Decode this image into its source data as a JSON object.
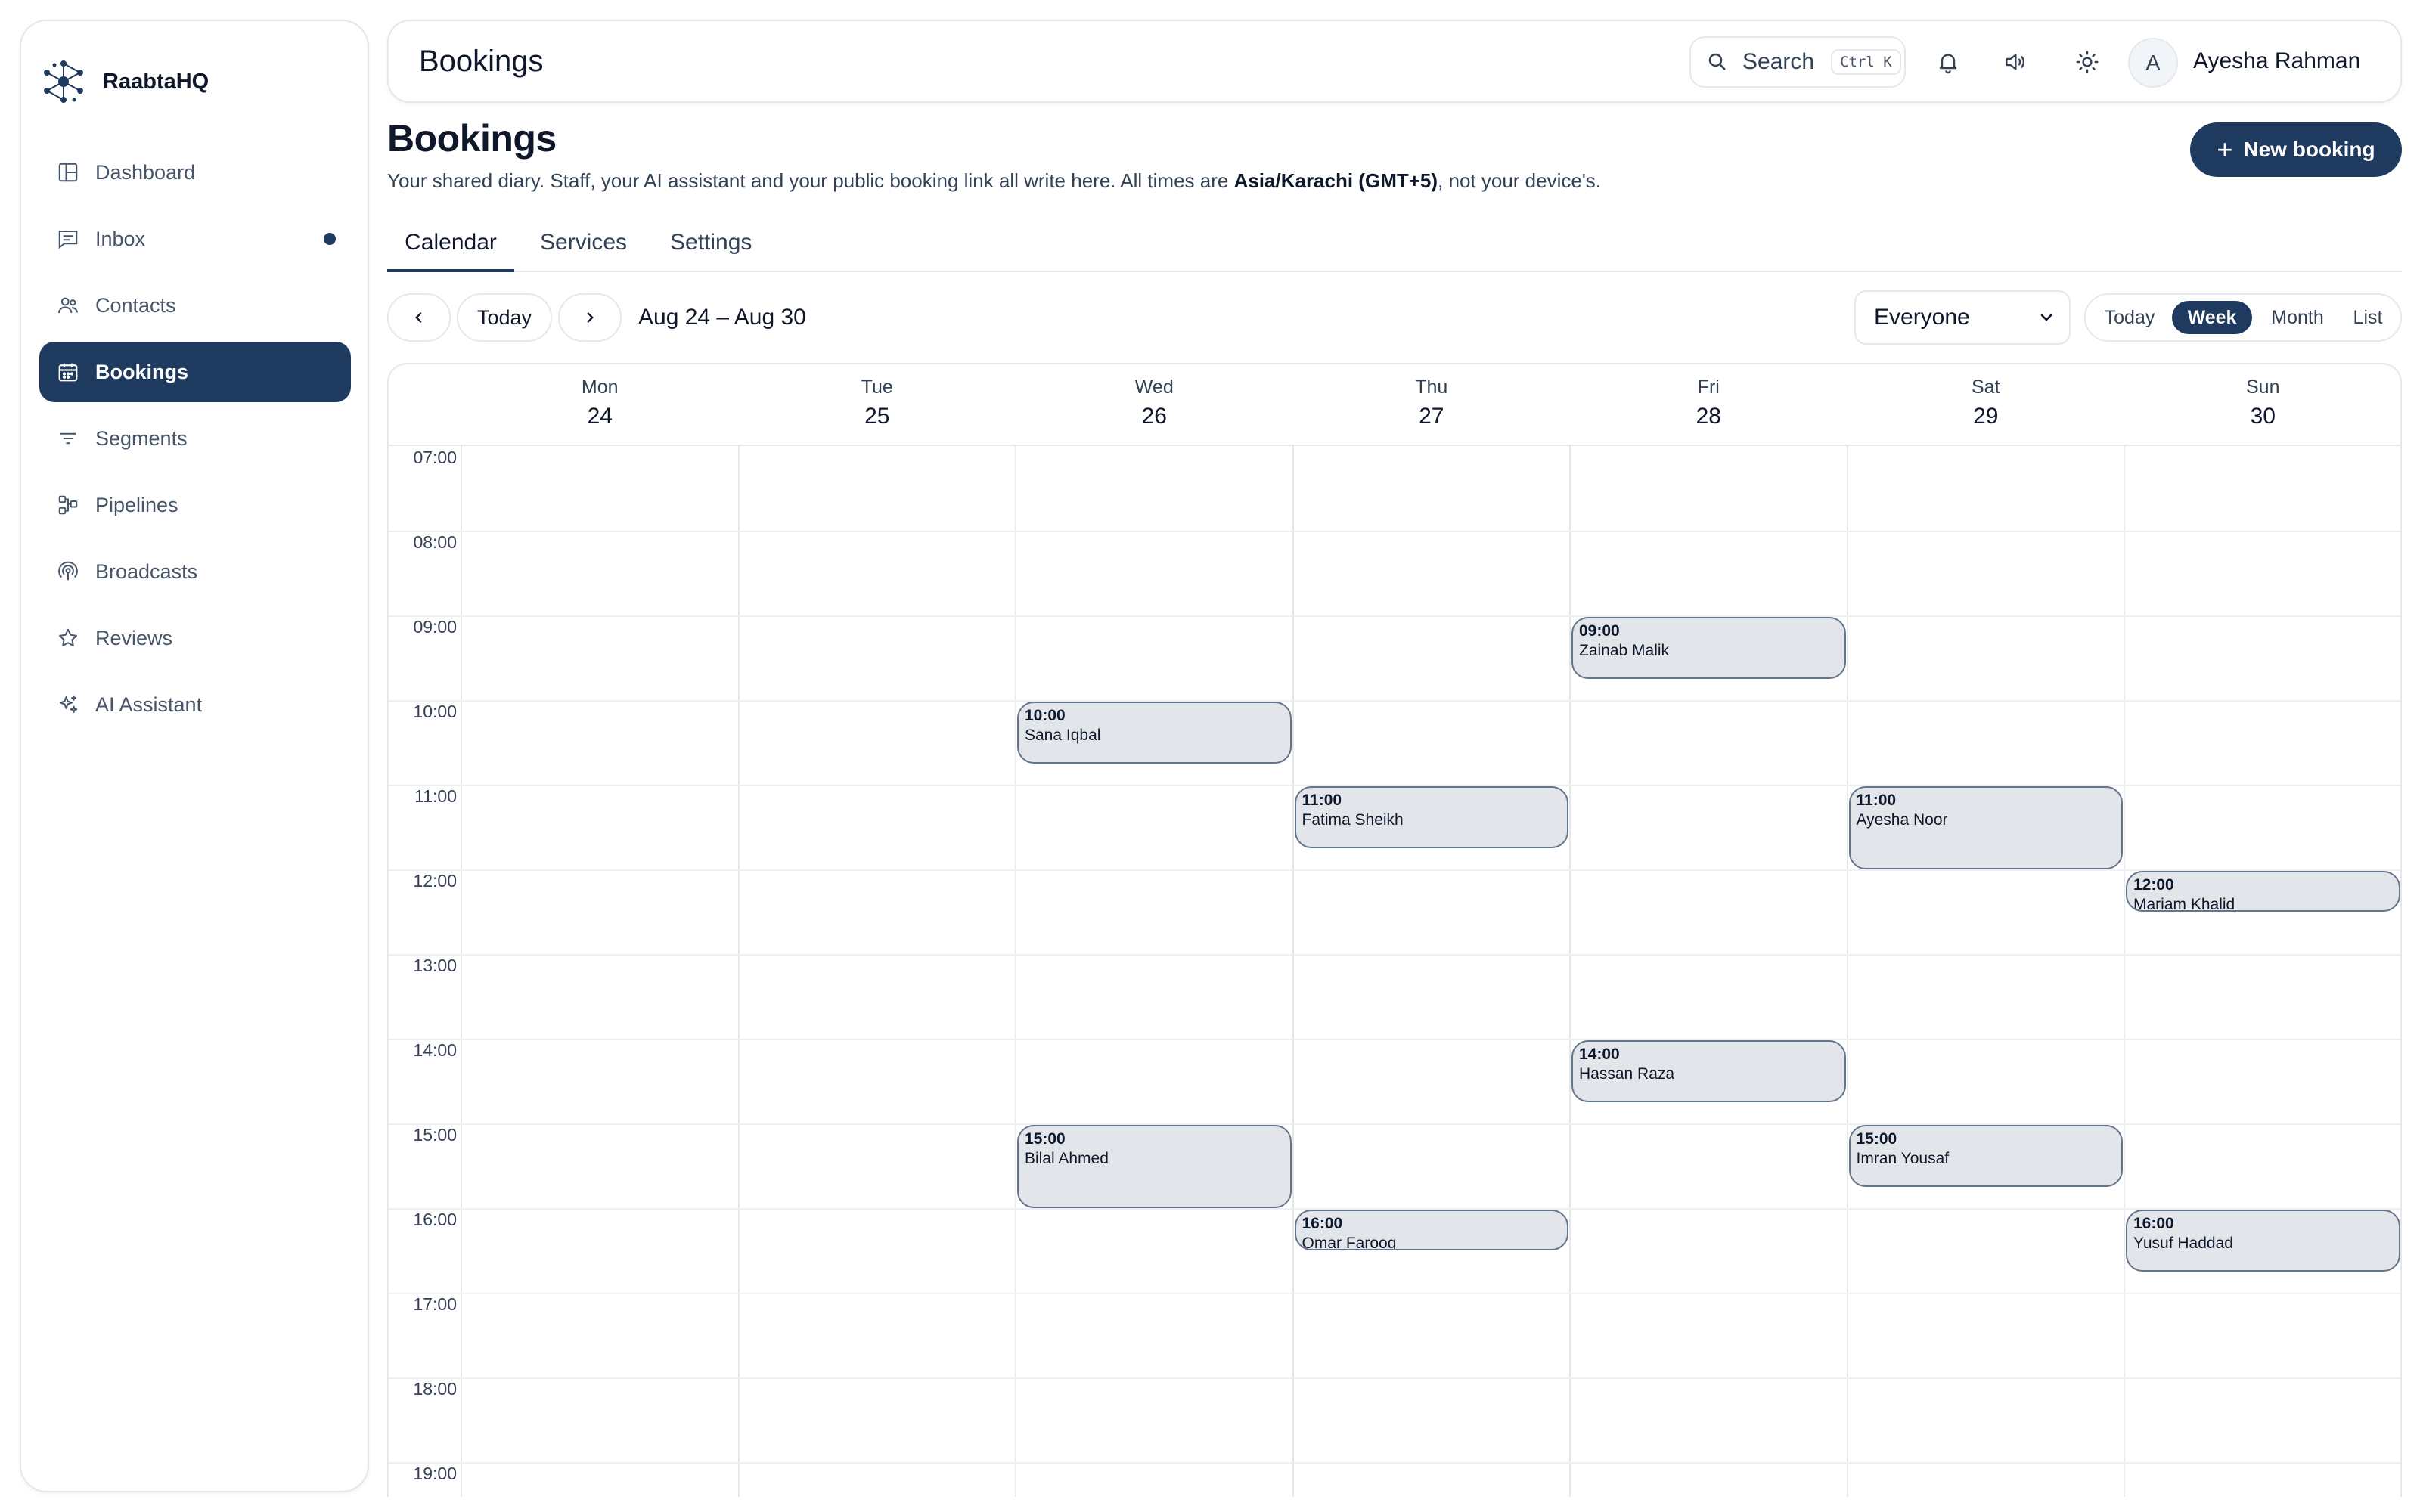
{
  "app": {
    "name": "RaabtaHQ"
  },
  "sidebar": {
    "items": [
      {
        "label": "Dashboard",
        "icon": "layout-icon",
        "active": false
      },
      {
        "label": "Inbox",
        "icon": "message-icon",
        "active": false,
        "unread": true
      },
      {
        "label": "Contacts",
        "icon": "users-icon",
        "active": false
      },
      {
        "label": "Bookings",
        "icon": "calendar-icon",
        "active": true
      },
      {
        "label": "Segments",
        "icon": "filter-icon",
        "active": false
      },
      {
        "label": "Pipelines",
        "icon": "pipeline-icon",
        "active": false
      },
      {
        "label": "Broadcasts",
        "icon": "broadcast-icon",
        "active": false
      },
      {
        "label": "Reviews",
        "icon": "star-icon",
        "active": false
      },
      {
        "label": "AI Assistant",
        "icon": "sparkles-icon",
        "active": false
      }
    ]
  },
  "header": {
    "title": "Bookings",
    "search_label": "Search",
    "search_shortcut": "Ctrl K",
    "user_initial": "A",
    "user_name": "Ayesha Rahman"
  },
  "page": {
    "title": "Bookings",
    "description_prefix": "Your shared diary. Staff, your AI assistant and your public booking link all write here. All times are ",
    "timezone": "Asia/Karachi (GMT+5)",
    "description_suffix": ", not your device's.",
    "new_booking_label": "New booking"
  },
  "tabs": [
    {
      "label": "Calendar",
      "active": true
    },
    {
      "label": "Services",
      "active": false
    },
    {
      "label": "Settings",
      "active": false
    }
  ],
  "toolbar": {
    "today_label": "Today",
    "range_label": "Aug 24 – Aug 30",
    "staff_filter": "Everyone",
    "views": [
      {
        "label": "Today",
        "active": false
      },
      {
        "label": "Week",
        "active": true
      },
      {
        "label": "Month",
        "active": false
      },
      {
        "label": "List",
        "active": false
      }
    ]
  },
  "calendar": {
    "days": [
      {
        "name": "Mon",
        "num": "24"
      },
      {
        "name": "Tue",
        "num": "25"
      },
      {
        "name": "Wed",
        "num": "26"
      },
      {
        "name": "Thu",
        "num": "27"
      },
      {
        "name": "Fri",
        "num": "28"
      },
      {
        "name": "Sat",
        "num": "29"
      },
      {
        "name": "Sun",
        "num": "30"
      }
    ],
    "hours": [
      "07:00",
      "08:00",
      "09:00",
      "10:00",
      "11:00",
      "12:00",
      "13:00",
      "14:00",
      "15:00",
      "16:00",
      "17:00",
      "18:00",
      "19:00"
    ],
    "events": [
      {
        "day": 4,
        "time": "09:00",
        "name": "Zainab Malik",
        "start": 9.0,
        "duration": 0.75
      },
      {
        "day": 2,
        "time": "10:00",
        "name": "Sana Iqbal",
        "start": 10.0,
        "duration": 0.75
      },
      {
        "day": 3,
        "time": "11:00",
        "name": "Fatima Sheikh",
        "start": 11.0,
        "duration": 0.75
      },
      {
        "day": 5,
        "time": "11:00",
        "name": "Ayesha Noor",
        "start": 11.0,
        "duration": 1.0
      },
      {
        "day": 6,
        "time": "12:00",
        "name": "Mariam Khalid",
        "start": 12.0,
        "duration": 0.5
      },
      {
        "day": 4,
        "time": "14:00",
        "name": "Hassan Raza",
        "start": 14.0,
        "duration": 0.75
      },
      {
        "day": 2,
        "time": "15:00",
        "name": "Bilal Ahmed",
        "start": 15.0,
        "duration": 1.0
      },
      {
        "day": 5,
        "time": "15:00",
        "name": "Imran Yousaf",
        "start": 15.0,
        "duration": 0.75
      },
      {
        "day": 3,
        "time": "16:00",
        "name": "Omar Farooq",
        "start": 16.0,
        "duration": 0.5
      },
      {
        "day": 6,
        "time": "16:00",
        "name": "Yusuf Haddad",
        "start": 16.0,
        "duration": 0.75
      }
    ]
  },
  "colors": {
    "primary": "#1e3a5f",
    "event_fill": "#e2e6ea",
    "event_border": "#64748b",
    "border": "#e5e7eb"
  }
}
